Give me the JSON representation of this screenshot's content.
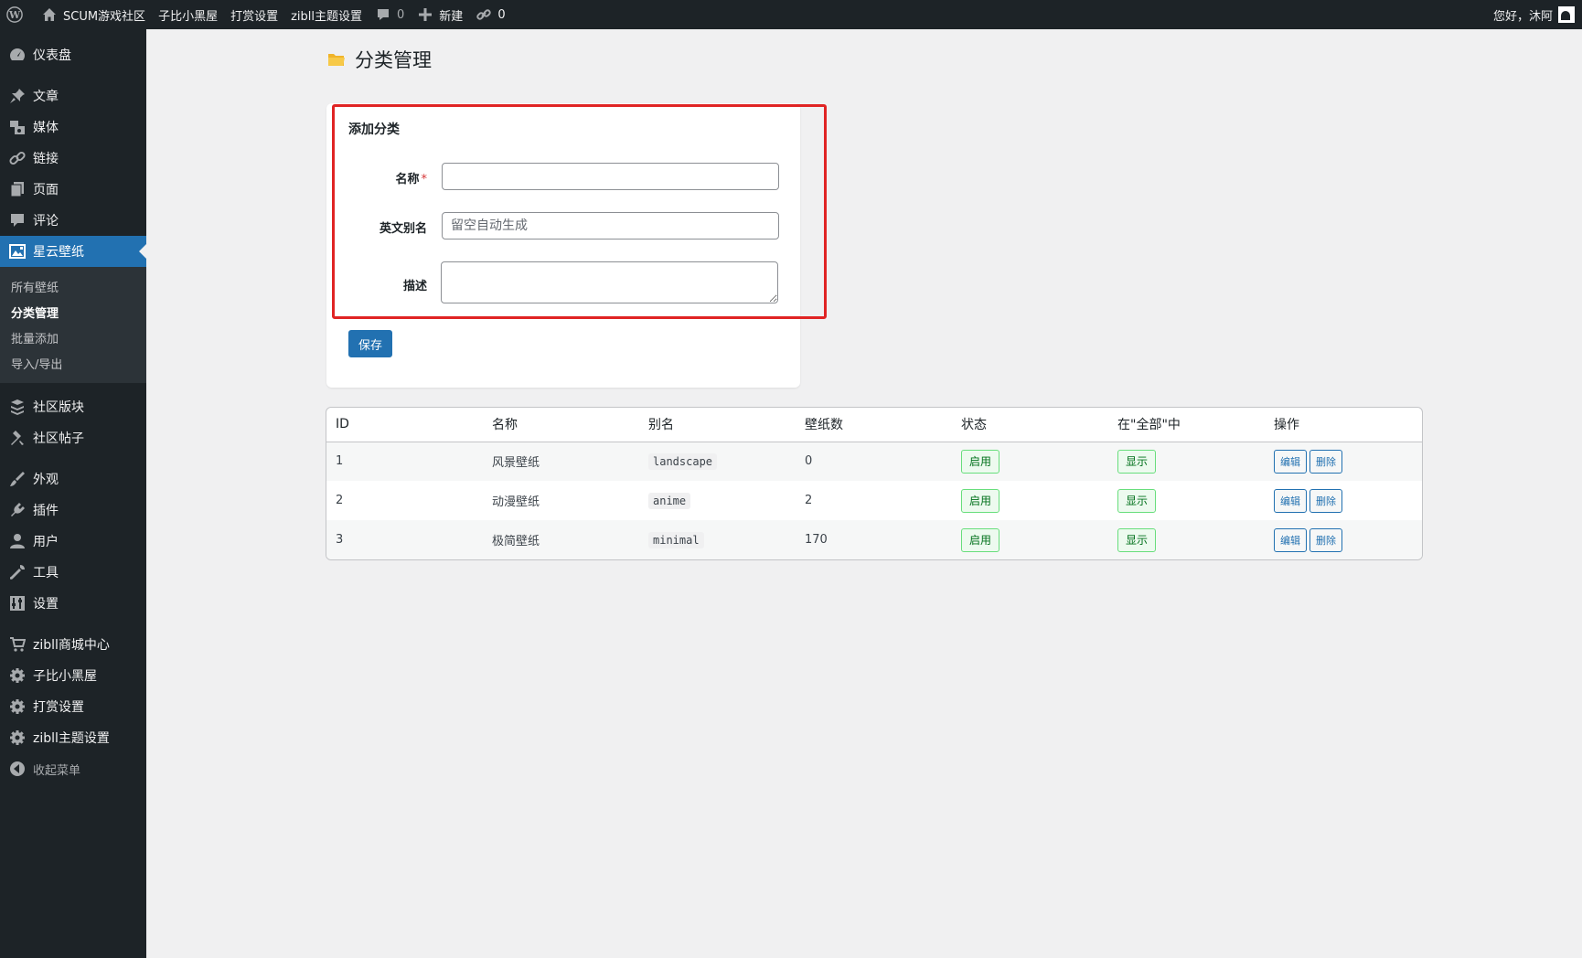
{
  "adminbar": {
    "site_name": "SCUM游戏社区",
    "links": [
      "子比小黑屋",
      "打赏设置",
      "zibll主题设置"
    ],
    "comments_count": "0",
    "new_label": "新建",
    "links_count": "0",
    "greeting": "您好，沐阿"
  },
  "sidebar": {
    "items": [
      {
        "label": "仪表盘",
        "icon": "dashboard-icon"
      },
      {
        "label": "文章",
        "icon": "pin-icon"
      },
      {
        "label": "媒体",
        "icon": "media-icon"
      },
      {
        "label": "链接",
        "icon": "link-icon"
      },
      {
        "label": "页面",
        "icon": "page-icon"
      },
      {
        "label": "评论",
        "icon": "comment-icon"
      },
      {
        "label": "星云壁纸",
        "icon": "wallpaper-icon"
      },
      {
        "label": "社区版块",
        "icon": "forum-icon"
      },
      {
        "label": "社区帖子",
        "icon": "hammer-icon"
      },
      {
        "label": "外观",
        "icon": "brush-icon"
      },
      {
        "label": "插件",
        "icon": "plugin-icon"
      },
      {
        "label": "用户",
        "icon": "user-icon"
      },
      {
        "label": "工具",
        "icon": "wrench-icon"
      },
      {
        "label": "设置",
        "icon": "settings-icon"
      },
      {
        "label": "zibll商城中心",
        "icon": "cart-icon"
      },
      {
        "label": "子比小黑屋",
        "icon": "gear-icon"
      },
      {
        "label": "打赏设置",
        "icon": "gear-icon"
      },
      {
        "label": "zibll主题设置",
        "icon": "gear-icon"
      },
      {
        "label": "收起菜单",
        "icon": "collapse-icon"
      }
    ],
    "submenu": [
      "所有壁纸",
      "分类管理",
      "批量添加",
      "导入/导出"
    ]
  },
  "page": {
    "title": "分类管理"
  },
  "form": {
    "title": "添加分类",
    "name_label": "名称",
    "name_required": "*",
    "name_value": "",
    "slug_label": "英文别名",
    "slug_placeholder": "留空自动生成",
    "desc_label": "描述",
    "desc_value": "",
    "save_label": "保存"
  },
  "table": {
    "headers": [
      "ID",
      "名称",
      "别名",
      "壁纸数",
      "状态",
      "在\"全部\"中",
      "操作"
    ],
    "rows": [
      {
        "id": "1",
        "name": "风景壁纸",
        "slug": "landscape",
        "count": "0",
        "status": "启用",
        "in_all": "显示"
      },
      {
        "id": "2",
        "name": "动漫壁纸",
        "slug": "anime",
        "count": "2",
        "status": "启用",
        "in_all": "显示"
      },
      {
        "id": "3",
        "name": "极简壁纸",
        "slug": "minimal",
        "count": "170",
        "status": "启用",
        "in_all": "显示"
      }
    ],
    "edit_label": "编辑",
    "delete_label": "删除"
  },
  "colors": {
    "accent": "#2271b1",
    "adminbar_bg": "#1d2327",
    "highlight": "#e02424",
    "status_green": "#68de7c"
  }
}
